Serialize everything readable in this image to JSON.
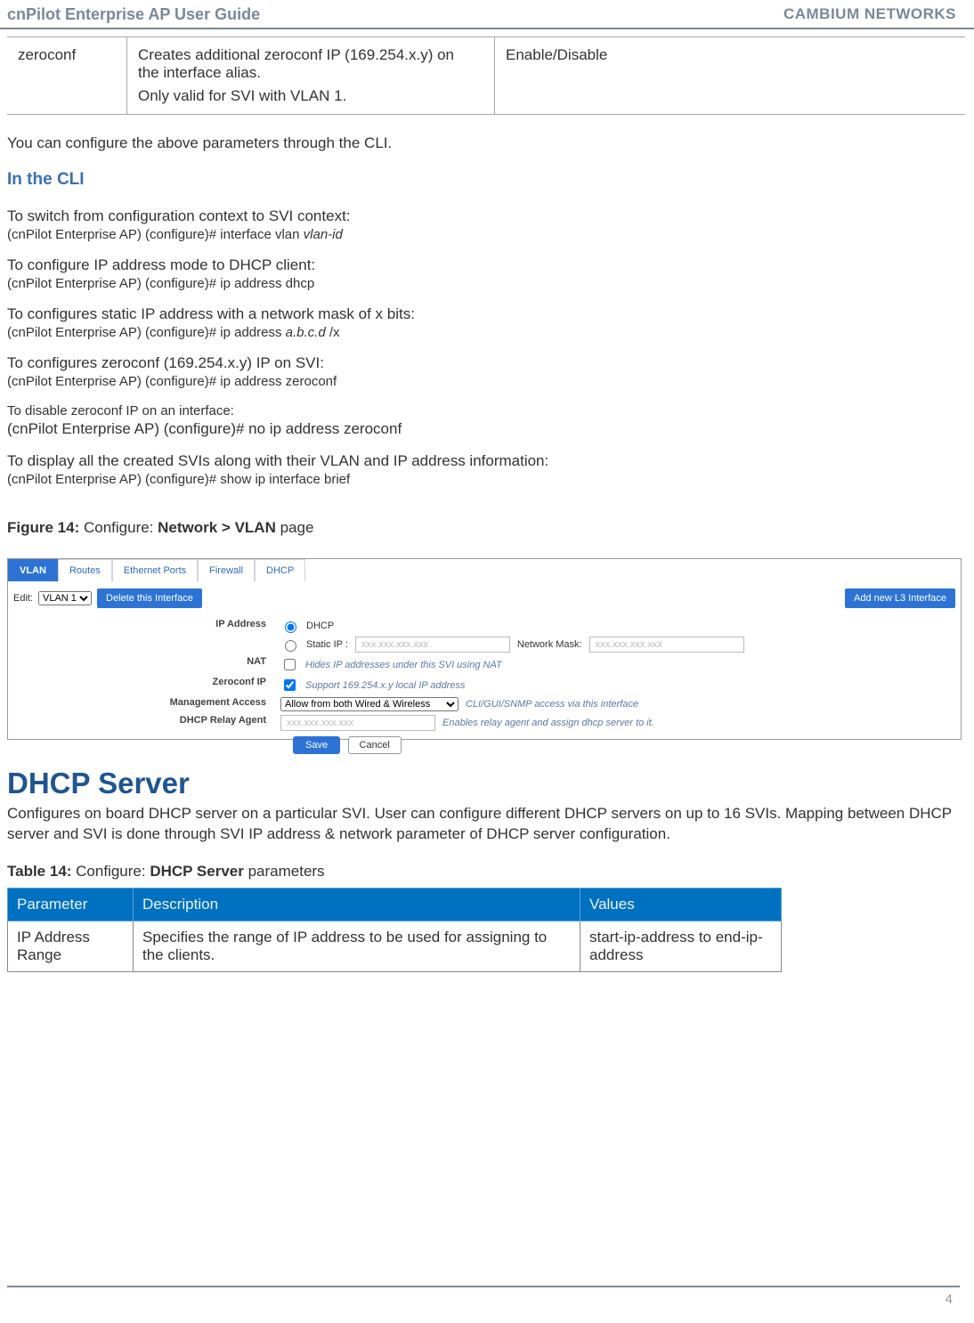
{
  "header": {
    "left": "cnPilot Enterprise AP User Guide",
    "right": "CAMBIUM NETWORKS"
  },
  "topTable": {
    "param": "zeroconf",
    "descLine1": "Creates additional zeroconf IP (169.254.x.y) on the interface alias.",
    "descLine2": "Only valid for SVI with VLAN 1.",
    "value": "Enable/Disable"
  },
  "introPara": "You can configure the above parameters through the CLI.",
  "cliHeading": "In the CLI",
  "cliItems": [
    {
      "title": "To switch from configuration context to SVI context:",
      "prefix": "(cnPilot Enterprise AP) (configure)# interface vlan ",
      "italic": "vlan-id",
      "suffix": ""
    },
    {
      "title": "To configure IP address mode to DHCP client:",
      "prefix": "(cnPilot Enterprise AP) (configure)# ip address  dhcp",
      "italic": "",
      "suffix": ""
    },
    {
      "title": "To configures static IP address with a network mask of x bits:",
      "prefix": "(cnPilot Enterprise AP) (configure)# ip address ",
      "italic": "a.b.c.d",
      "suffix": " /x"
    },
    {
      "title": "To configures zeroconf (169.254.x.y) IP on SVI:",
      "prefix": "(cnPilot Enterprise AP) (configure)# ip address zeroconf",
      "italic": "",
      "suffix": ""
    },
    {
      "title": "To disable zeroconf IP on an interface:",
      "titleSmall": true,
      "prefix": "(cnPilot Enterprise AP) (configure)# no ip address zeroconf",
      "italic": "",
      "suffix": "",
      "cmdLarge": true
    },
    {
      "title": "To display all the created SVIs along with their VLAN and IP address information:",
      "prefix": "(cnPilot Enterprise AP) (configure)# show ip interface brief",
      "italic": "",
      "suffix": ""
    }
  ],
  "figCaption": {
    "pre": "Figure 14: ",
    "mid": "Configure: ",
    "bold": "Network > VLAN",
    "post": " page"
  },
  "shot": {
    "tabs": [
      "VLAN",
      "Routes",
      "Ethernet Ports",
      "Firewall",
      "DHCP"
    ],
    "editLabel": "Edit:",
    "editOption": "VLAN 1",
    "deleteBtn": "Delete this Interface",
    "addBtn": "Add new L3 Interface",
    "rows": {
      "ipaddr": {
        "label": "IP Address",
        "dhcp": "DHCP",
        "static": "Static  IP :",
        "ph": "xxx.xxx.xxx.xxx",
        "maskLabel": "Network Mask:",
        "maskPh": "xxx.xxx.xxx.xxx"
      },
      "nat": {
        "label": "NAT",
        "hint": "Hides IP addresses under this SVI using NAT"
      },
      "zero": {
        "label": "Zeroconf IP",
        "hint": "Support 169.254.x.y local IP address"
      },
      "mgmt": {
        "label": "Management Access",
        "option": "Allow from both Wired & Wireless",
        "hint": "CLI/GUI/SNMP access via this interface"
      },
      "relay": {
        "label": "DHCP Relay Agent",
        "ph": "xxx.xxx.xxx.xxx",
        "hint": "Enables relay agent and assign dhcp server to it."
      }
    },
    "save": "Save",
    "cancel": "Cancel"
  },
  "dhcpHeading": "DHCP Server",
  "dhcpDesc": "Configures on board DHCP server on a particular SVI. User can configure different DHCP servers on up to 16 SVIs. Mapping between DHCP server and SVI is done through SVI IP address & network parameter of DHCP server configuration.",
  "tblCaption": {
    "pre": "Table 14: ",
    "mid": "Configure: ",
    "bold": "DHCP Server",
    "post": " parameters"
  },
  "paramTable": {
    "headers": [
      "Parameter",
      "Description",
      "Values"
    ],
    "row": {
      "param": "IP Address Range",
      "desc": "Specifies the range of IP address to be used for assigning to the clients.",
      "values": "start-ip-address to end-ip-address"
    }
  },
  "pageNum": "4"
}
